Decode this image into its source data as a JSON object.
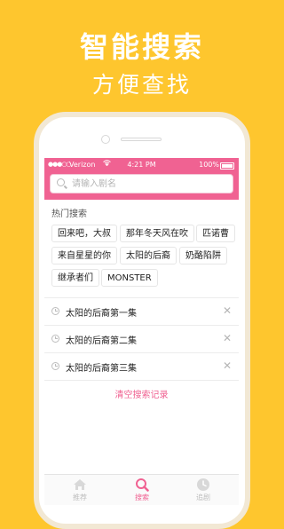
{
  "promo": {
    "title": "智能搜索",
    "subtitle": "方便查找"
  },
  "status_bar": {
    "signal": "●●●○○",
    "carrier": "Verizon",
    "time": "4:21 PM",
    "battery": "100%"
  },
  "search": {
    "placeholder": "请输入剧名"
  },
  "hot": {
    "label": "热门搜索",
    "tags": [
      "回来吧，大叔",
      "那年冬天风在吹",
      "匹诺曹",
      "来自星星的你",
      "太阳的后裔",
      "奶酪陷阱",
      "继承者们",
      "MONSTER"
    ]
  },
  "history": {
    "items": [
      "太阳的后裔第一集",
      "太阳的后裔第二集",
      "太阳的后裔第三集"
    ],
    "clear_label": "清空搜索记录"
  },
  "tabs": [
    {
      "label": "推荐",
      "icon": "home-icon"
    },
    {
      "label": "搜索",
      "icon": "search-icon"
    },
    {
      "label": "追剧",
      "icon": "clock-icon"
    }
  ],
  "colors": {
    "background": "#FEC62E",
    "accent": "#F06292"
  }
}
